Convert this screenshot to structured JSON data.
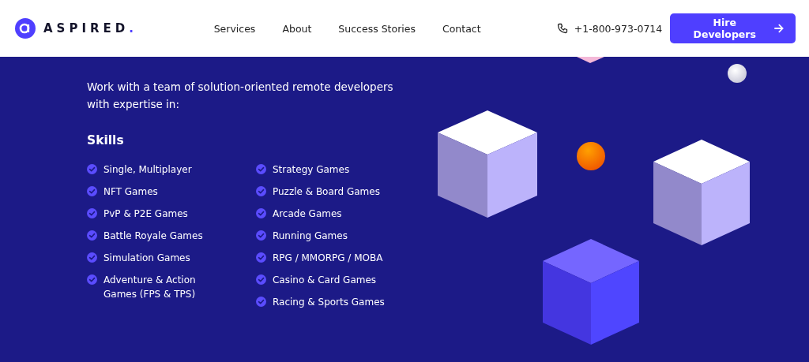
{
  "header": {
    "logo": {
      "name": "ASPIRED",
      "dot": "."
    },
    "nav": [
      {
        "label": "Services"
      },
      {
        "label": "About"
      },
      {
        "label": "Success Stories"
      },
      {
        "label": "Contact"
      }
    ],
    "phone": "+1-800-973-0714",
    "cta": "Hire Developers"
  },
  "intro": "Work with a team of solution-oriented remote developers with expertise in:",
  "skills": {
    "title": "Skills",
    "columns": [
      [
        "Single, Multiplayer",
        "NFT Games",
        "PvP & P2E Games",
        "Battle Royale Games",
        "Simulation Games",
        "Adventure & Action Games (FPS & TPS)"
      ],
      [
        "Strategy Games",
        "Puzzle & Board Games",
        "Arcade Games",
        "Running Games",
        "RPG / MMORPG / MOBA",
        "Casino & Card Games",
        "Racing & Sports Games"
      ]
    ]
  }
}
